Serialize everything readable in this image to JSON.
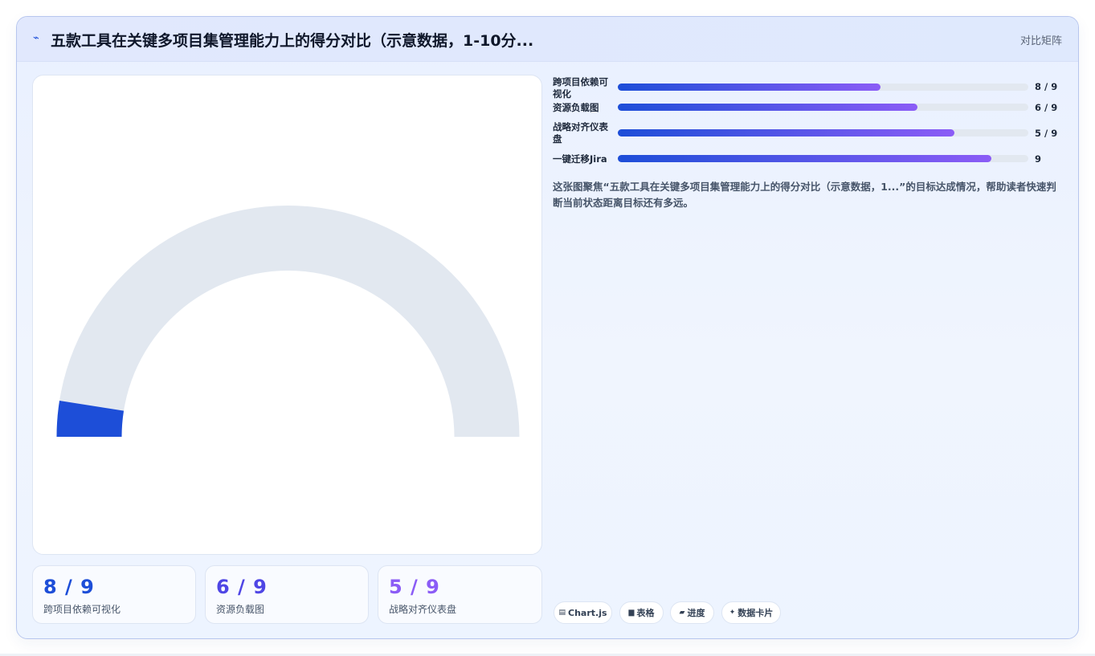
{
  "header": {
    "icon": "pulse-icon",
    "title": "五款工具在关键多项目集管理能力上的得分对比（示意数据，1-10分...",
    "tag": "对比矩阵"
  },
  "chart_data": {
    "type": "gauge",
    "gauge_value": 0.05,
    "bars": [
      {
        "label": "跨项目依赖可视化",
        "display": "8 / 9",
        "fraction": 0.64
      },
      {
        "label": "资源负载图",
        "display": "6 / 9",
        "fraction": 0.73
      },
      {
        "label": "战略对齐仪表盘",
        "display": "5 / 9",
        "fraction": 0.82
      },
      {
        "label": "一键迁移Jira",
        "display": "9",
        "fraction": 0.91
      }
    ],
    "stats": [
      {
        "value": "8 / 9",
        "label": "跨项目依赖可视化",
        "color": "#1d4ed8"
      },
      {
        "value": "6 / 9",
        "label": "资源负载图",
        "color": "#4f46e5"
      },
      {
        "value": "5 / 9",
        "label": "战略对齐仪表盘",
        "color": "#8b5cf6"
      }
    ]
  },
  "description": "这张图聚焦“五款工具在关键多项目集管理能力上的得分对比（示意数据，1...”的目标达成情况，帮助读者快速判断当前状态距离目标还有多远。",
  "chips": [
    {
      "icon": "chart-icon",
      "glyph": "▤",
      "label": "Chart.js"
    },
    {
      "icon": "table-icon",
      "glyph": "▆",
      "label": "表格"
    },
    {
      "icon": "progress-icon",
      "glyph": "▰",
      "label": "进度"
    },
    {
      "icon": "sparkle-icon",
      "glyph": "✦",
      "label": "数据卡片"
    }
  ],
  "colors": {
    "accent": "#1d4ed8",
    "accent_end": "#8b5cf6",
    "track": "#e2e8f0"
  }
}
